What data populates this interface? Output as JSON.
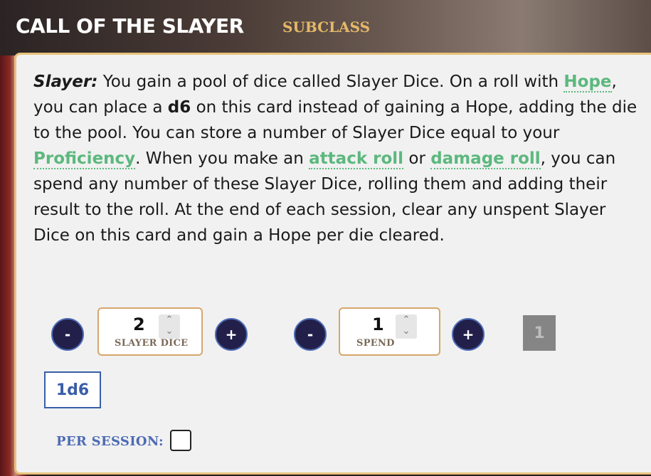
{
  "header": {
    "title": "CALL OF THE SLAYER",
    "subtitle": "SUBCLASS"
  },
  "description": {
    "lead": "Slayer:",
    "t1": " You gain a pool of dice called Slayer Dice. On a roll with ",
    "kw_hope": "Hope",
    "t2": ", you can place a ",
    "die": "d6",
    "t3": " on this card instead of gaining a Hope, adding the die to the pool. You can store a number of Slayer Dice equal to your ",
    "kw_proficiency": "Proficiency",
    "t4": ". When you make an ",
    "kw_attack": "attack roll",
    "t5": " or ",
    "kw_damage": "damage roll",
    "t6": ", you can spend any number of these Slayer Dice, rolling them and adding their result to the roll. At the end of each session, clear any unspent Slayer Dice on this card and gain a Hope per die cleared."
  },
  "controls": {
    "minus": "-",
    "plus": "+",
    "spinner_up": "⌃",
    "spinner_down": "⌄",
    "slayer_dice": {
      "value": "2",
      "label": "SLAYER DICE"
    },
    "spend": {
      "value": "1",
      "label": "SPEND"
    },
    "result": "1",
    "die_button": "1d6",
    "per_session_label": "PER SESSION:"
  },
  "colors": {
    "keyword": "#5cb87e",
    "subtitle": "#e4b868",
    "card_border": "#e8c27a",
    "button_bg": "#22204a",
    "accent_blue": "#4d6bb5"
  }
}
